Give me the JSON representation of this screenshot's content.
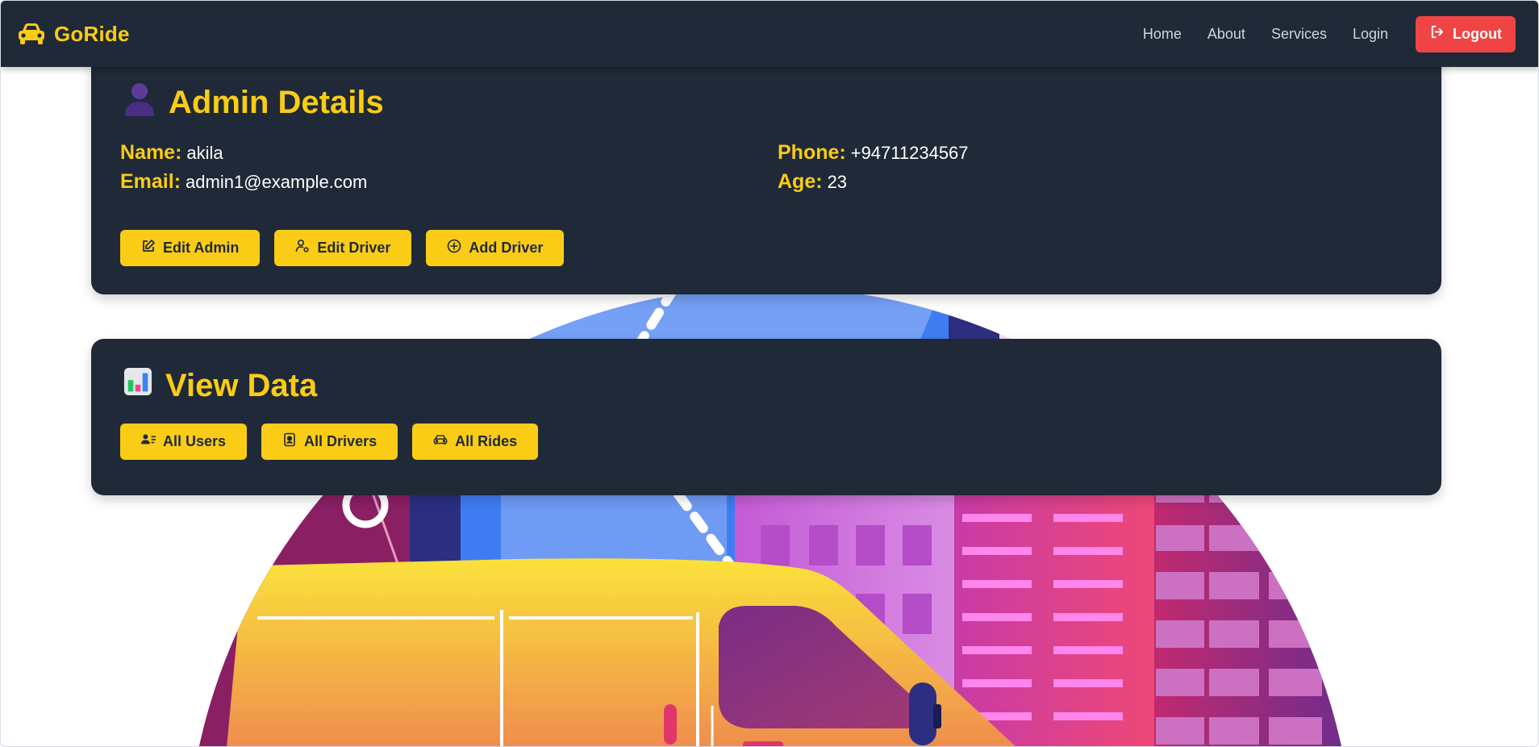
{
  "navbar": {
    "brand": "GoRide",
    "brand_icon": "car-icon",
    "links": [
      "Home",
      "About",
      "Services",
      "Login"
    ],
    "logout_label": "Logout",
    "logout_icon": "sign-out-icon"
  },
  "admin": {
    "title": "Admin Details",
    "title_icon": "person-silhouette-icon",
    "fields": [
      {
        "label": "Name:",
        "value": "akila"
      },
      {
        "label": "Phone:",
        "value": "+94711234567"
      },
      {
        "label": "Email:",
        "value": "admin1@example.com"
      },
      {
        "label": "Age:",
        "value": "23"
      }
    ],
    "buttons": [
      {
        "label": "Edit Admin",
        "icon": "edit-icon"
      },
      {
        "label": "Edit Driver",
        "icon": "user-gear-icon"
      },
      {
        "label": "Add Driver",
        "icon": "plus-circle-icon"
      }
    ]
  },
  "view_data": {
    "title": "View Data",
    "title_icon": "bar-chart-icon",
    "buttons": [
      {
        "label": "All Users",
        "icon": "users-list-icon"
      },
      {
        "label": "All Drivers",
        "icon": "id-badge-icon"
      },
      {
        "label": "All Rides",
        "icon": "car-front-icon"
      }
    ]
  },
  "colors": {
    "navbar_bg": "#1f2937",
    "accent": "#facc15",
    "logout": "#ef4444",
    "card_bg": "#1f2937"
  }
}
